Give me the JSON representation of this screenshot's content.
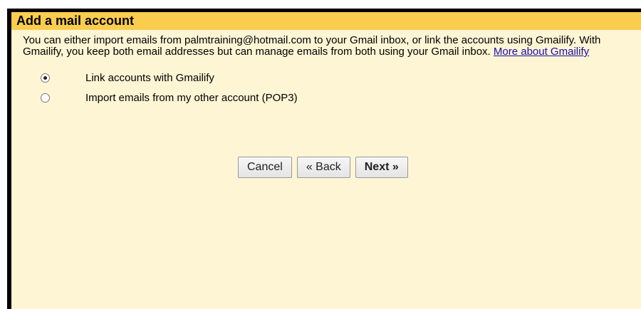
{
  "dialog": {
    "title": "Add a mail account",
    "description": "You can either import emails from palmtraining@hotmail.com to your Gmail inbox, or link the accounts using Gmailify. With Gmailify, you keep both email addresses but can manage emails from both using your Gmail inbox.",
    "link_text": "More about Gmailify"
  },
  "options": [
    {
      "label": "Link accounts with Gmailify",
      "checked": true
    },
    {
      "label": "Import emails from my other account (POP3)",
      "checked": false
    }
  ],
  "buttons": {
    "cancel": "Cancel",
    "back": "« Back",
    "next": "Next »"
  },
  "colors": {
    "title_bar": "#fbcd4e",
    "background": "#fdf5d4",
    "link": "#1a0dab"
  }
}
